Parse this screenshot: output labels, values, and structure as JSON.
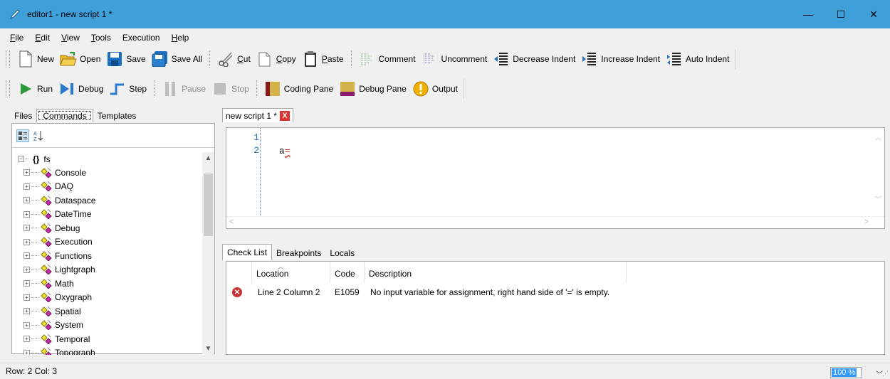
{
  "window": {
    "title": "editor1 - new script 1 *",
    "accent": "#3f9fd9"
  },
  "menu": {
    "items": [
      {
        "label": "File",
        "mnemonic": "F",
        "rest": "ile"
      },
      {
        "label": "Edit",
        "mnemonic": "E",
        "rest": "dit"
      },
      {
        "label": "View",
        "mnemonic": "V",
        "rest": "iew"
      },
      {
        "label": "Tools",
        "mnemonic": "T",
        "rest": "ools"
      },
      {
        "label": "Execution",
        "mnemonic": "",
        "rest": "Execution"
      },
      {
        "label": "Help",
        "mnemonic": "H",
        "rest": "elp"
      }
    ]
  },
  "toolbar1": {
    "new": "New",
    "open": "Open",
    "save": "Save",
    "save_all": "Save All",
    "cut_m": "C",
    "cut_r": "ut",
    "copy_m": "C",
    "copy_r": "opy",
    "paste_m": "P",
    "paste_r": "aste",
    "comment": "Comment",
    "uncomment": "Uncomment",
    "decrease_indent": "Decrease Indent",
    "increase_indent": "Increase Indent",
    "auto_indent": "Auto Indent"
  },
  "toolbar2": {
    "run": "Run",
    "debug": "Debug",
    "step": "Step",
    "pause": "Pause",
    "stop": "Stop",
    "coding_pane": "Coding Pane",
    "debug_pane": "Debug Pane",
    "output": "Output"
  },
  "left": {
    "tabs": [
      "Files",
      "Commands",
      "Templates"
    ],
    "root": "fs",
    "items": [
      "Console",
      "DAQ",
      "Dataspace",
      "DateTime",
      "Debug",
      "Execution",
      "Functions",
      "Lightgraph",
      "Math",
      "Oxygraph",
      "Spatial",
      "System",
      "Temporal",
      "Topograph"
    ]
  },
  "editor": {
    "tab_label": "new script 1 *",
    "line_numbers": [
      "1",
      "2"
    ],
    "code_var": "a",
    "code_err": "="
  },
  "bottom": {
    "tabs": [
      "Check List",
      "Breakpoints",
      "Locals"
    ],
    "columns": {
      "location": "Location",
      "code": "Code",
      "description": "Description"
    },
    "rows": [
      {
        "location": "Line 2 Column 2",
        "code": "E1059",
        "description": "No input variable for assignment, right hand side of '=' is empty."
      }
    ]
  },
  "status": {
    "position": "Row: 2  Col: 3",
    "zoom": "100 %"
  }
}
